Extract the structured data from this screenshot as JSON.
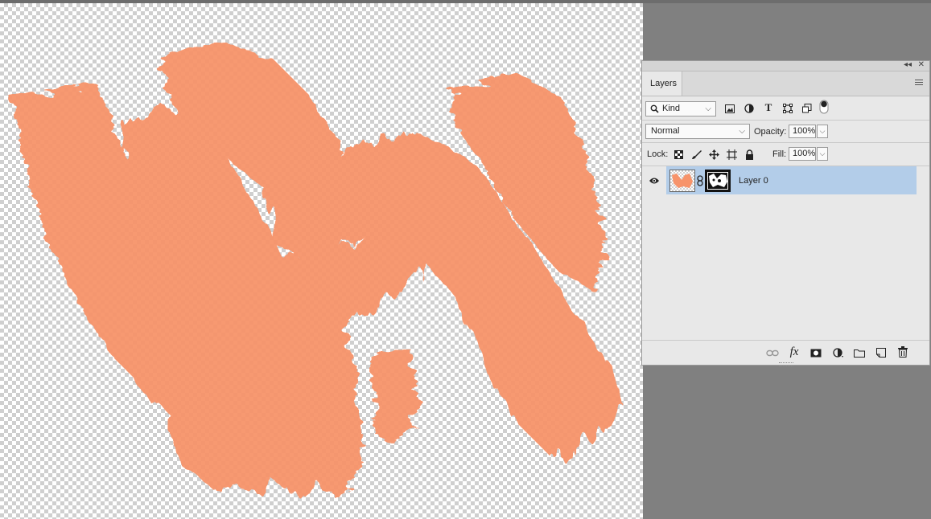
{
  "panel": {
    "collapse_label": "◂◂",
    "close_label": "✕",
    "tab_label": "Layers",
    "filter": {
      "value": "Kind"
    },
    "blend_mode": {
      "value": "Normal"
    },
    "opacity": {
      "label": "Opacity:",
      "value": "100%"
    },
    "lock": {
      "label": "Lock:"
    },
    "fill": {
      "label": "Fill:",
      "value": "100%"
    },
    "layers": [
      {
        "name": "Layer 0",
        "visible": true,
        "selected": true
      }
    ],
    "filter_icons": [
      "image-filter-icon",
      "adjustment-filter-icon",
      "type-filter-icon",
      "shape-filter-icon",
      "smart-object-filter-icon"
    ],
    "lock_icons": [
      "lock-transparent-icon",
      "lock-image-icon",
      "lock-position-icon",
      "lock-artboard-icon",
      "lock-all-icon"
    ],
    "bottom_icons": [
      "link-layers-icon",
      "fx-icon",
      "add-mask-icon",
      "adjustment-layer-icon",
      "new-group-icon",
      "new-layer-icon",
      "trash-icon"
    ],
    "fx_label": "fx"
  },
  "colors": {
    "paint": "#f7946b",
    "selection": "#b3cde9",
    "panel_bg": "#e8e8e8",
    "workspace": "#808080"
  }
}
